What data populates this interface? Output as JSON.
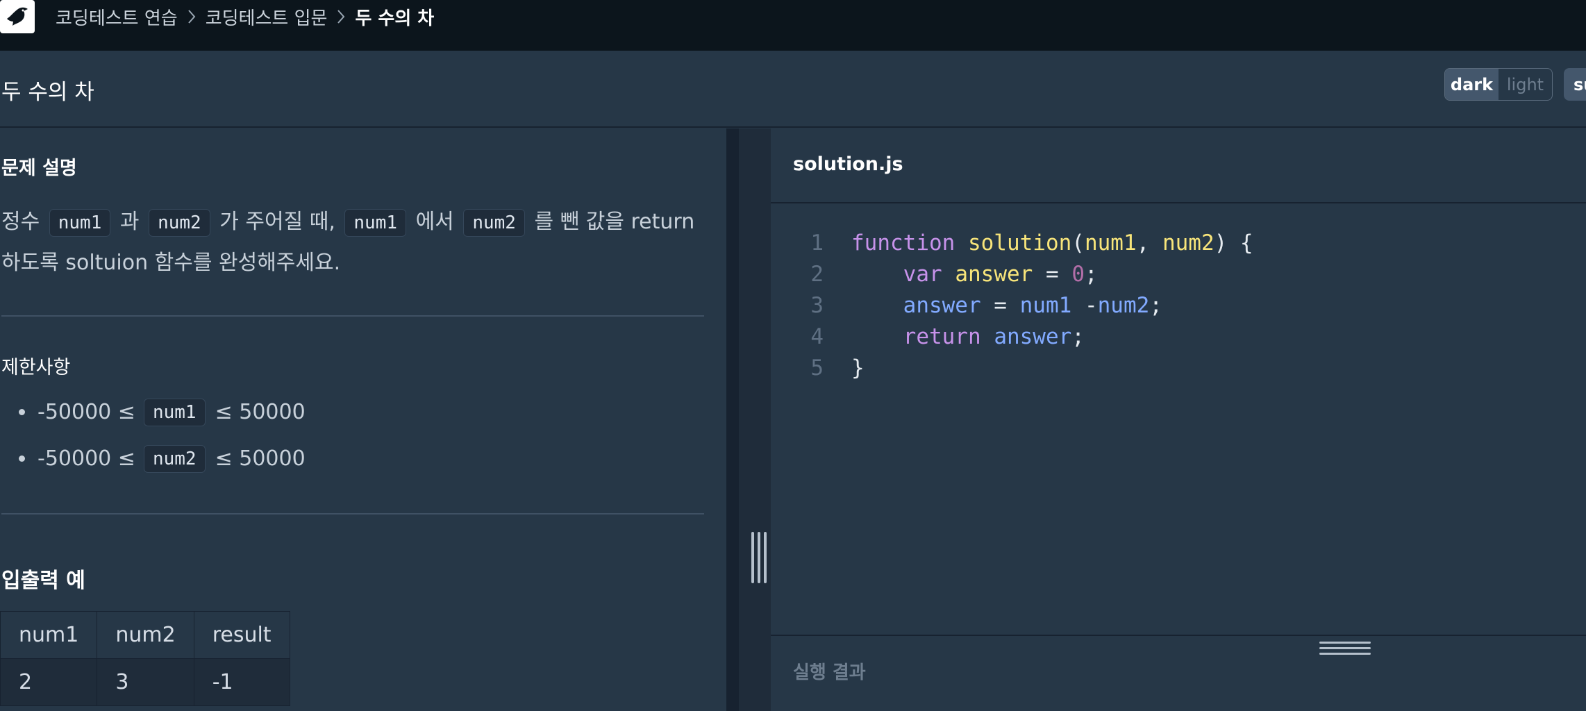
{
  "nav": {
    "breadcrumbs": [
      "코딩테스트 연습",
      "코딩테스트 입문",
      "두 수의 차"
    ]
  },
  "header": {
    "title": "두 수의 차",
    "theme_dark": "dark",
    "theme_light": "light",
    "extra_button": "submit"
  },
  "problem": {
    "desc_heading": "문제 설명",
    "desc": {
      "t1": "정수",
      "v1": "num1",
      "t2": "과",
      "v2": "num2",
      "t3": "가 주어질 때,",
      "v3": "num1",
      "t4": "에서",
      "v4": "num2",
      "t5": "를 뺀 값을 return하도록 soltuion 함수를 완성해주세요."
    },
    "constraints_heading": "제한사항",
    "constraints": [
      {
        "pre": "-50000 ≤",
        "code": "num1",
        "post": "≤ 50000"
      },
      {
        "pre": "-50000 ≤",
        "code": "num2",
        "post": "≤ 50000"
      }
    ],
    "examples_heading": "입출력 예",
    "table": {
      "headers": [
        "num1",
        "num2",
        "result"
      ],
      "rows": [
        [
          "2",
          "3",
          "-1"
        ]
      ]
    }
  },
  "editor": {
    "filename": "solution.js",
    "line_numbers": [
      "1",
      "2",
      "3",
      "4",
      "5"
    ],
    "code": {
      "l1": {
        "kw": "function",
        "fn": "solution",
        "open": "(",
        "a1": "num1",
        "comma": ", ",
        "a2": "num2",
        "close": ") {"
      },
      "l2": {
        "indent": "    ",
        "kw": "var",
        "id": "answer",
        "eq": " = ",
        "num": "0",
        "end": ";"
      },
      "l3": {
        "indent": "    ",
        "id": "answer",
        "eq": " = ",
        "a1": "num1",
        "op": " -",
        "a2": "num2",
        "end": ";"
      },
      "l4": {
        "indent": "    ",
        "kw": "return",
        "id": "answer",
        "end": ";"
      },
      "l5": {
        "brace": "}"
      }
    }
  },
  "result": {
    "label": "실행 결과"
  }
}
